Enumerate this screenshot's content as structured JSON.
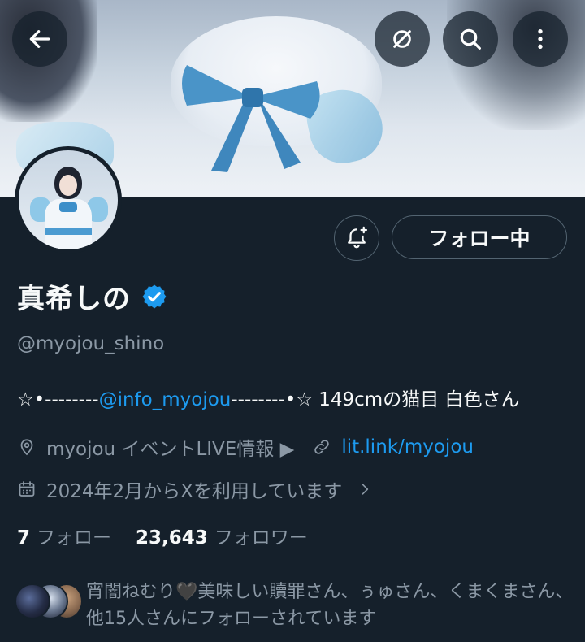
{
  "header": {
    "back_icon": "arrow-left-icon",
    "grok_icon": "grok-icon",
    "search_icon": "search-icon",
    "more_icon": "more-vertical-icon"
  },
  "profile": {
    "display_name": "真希しの",
    "verified": true,
    "handle": "@myojou_shino",
    "bio_prefix": "☆•--------",
    "bio_mention": "@info_myojou",
    "bio_suffix": "--------•☆ 149cmの猫目 白色さん",
    "location": "myojou イベントLIVE情報 ▶",
    "website": "lit.link/myojou",
    "joined": "2024年2月からXを利用しています",
    "following_count": "7",
    "following_label": "フォロー",
    "followers_count": "23,643",
    "followers_label": "フォロワー",
    "followed_by_text": "宵闇ねむり🖤美味しい贖罪さん、ぅゅさん、くまくまさん、他15人さんにフォローされています"
  },
  "actions": {
    "follow_label": "フォロー中"
  },
  "colors": {
    "background": "#15202b",
    "accent": "#1d9bf0",
    "secondary_text": "#8b98a5",
    "border": "#536471"
  }
}
